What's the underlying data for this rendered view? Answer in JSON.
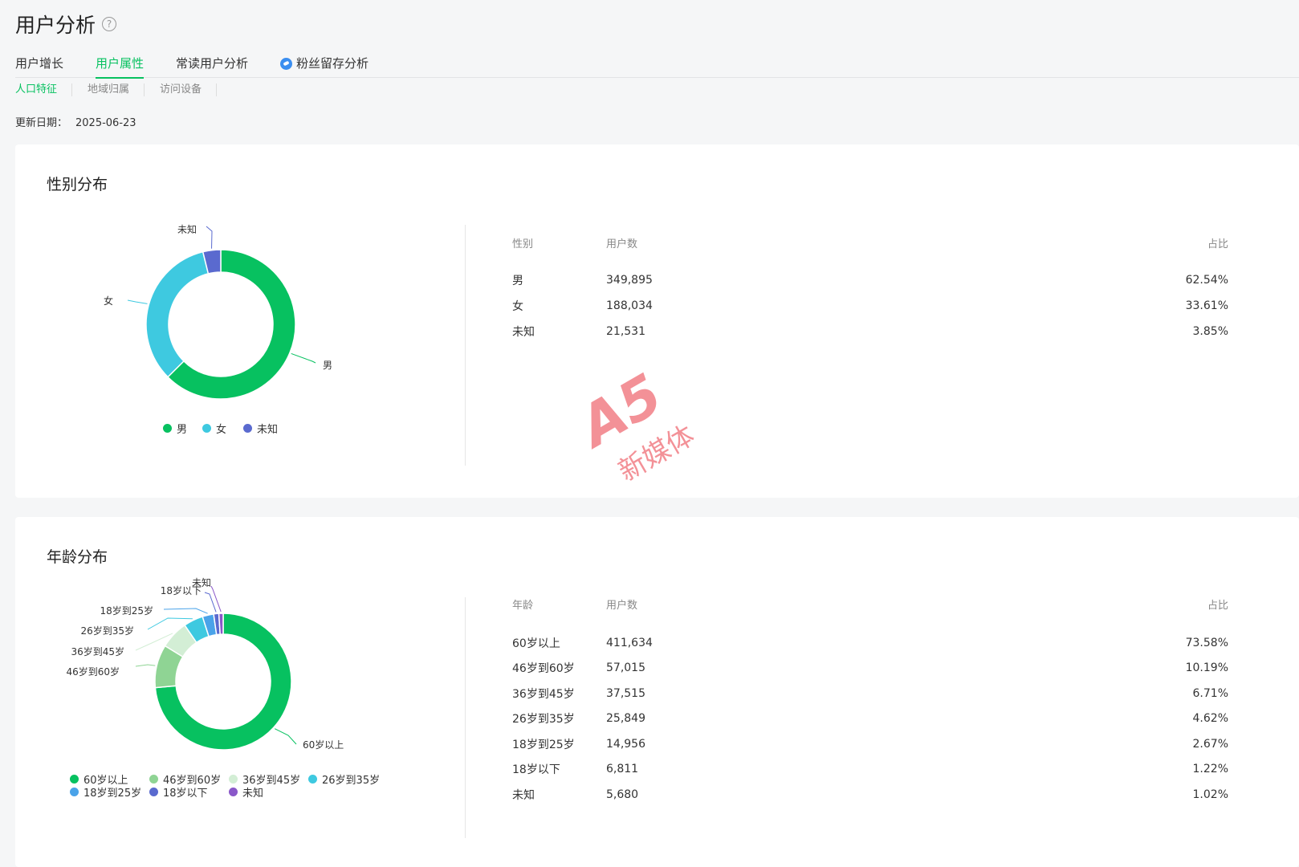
{
  "page": {
    "title": "用户分析",
    "help_icon": "question-circle-icon"
  },
  "tabs": [
    {
      "label": "用户增长",
      "active": false
    },
    {
      "label": "用户属性",
      "active": true
    },
    {
      "label": "常读用户分析",
      "active": false
    },
    {
      "label": "粉丝留存分析",
      "active": false,
      "icon": "badge-icon"
    }
  ],
  "subtabs": [
    {
      "label": "人口特征",
      "active": true
    },
    {
      "label": "地域归属",
      "active": false
    },
    {
      "label": "访问设备",
      "active": false
    }
  ],
  "update": {
    "label": "更新日期：",
    "date": "2025-06-23"
  },
  "colors": {
    "accent": "#07c160",
    "male": "#07c160",
    "female": "#3ec9e0",
    "unknown_gender": "#5a6acf",
    "age_60plus": "#07c160",
    "age_46_60": "#8fd494",
    "age_36_45": "#d3eed5",
    "age_26_35": "#3ec9e0",
    "age_18_25": "#4aa3e9",
    "age_under18": "#5a6acf",
    "age_unknown": "#8a58c9"
  },
  "gender": {
    "title": "性别分布",
    "headers": {
      "c1": "性别",
      "c2": "用户数",
      "c3": "占比"
    },
    "rows": [
      {
        "label": "男",
        "users": "349,895",
        "pct": "62.54%"
      },
      {
        "label": "女",
        "users": "188,034",
        "pct": "33.61%"
      },
      {
        "label": "未知",
        "users": "21,531",
        "pct": "3.85%"
      }
    ],
    "legend": [
      "男",
      "女",
      "未知"
    ]
  },
  "age": {
    "title": "年龄分布",
    "headers": {
      "c1": "年龄",
      "c2": "用户数",
      "c3": "占比"
    },
    "rows": [
      {
        "label": "60岁以上",
        "users": "411,634",
        "pct": "73.58%"
      },
      {
        "label": "46岁到60岁",
        "users": "57,015",
        "pct": "10.19%"
      },
      {
        "label": "36岁到45岁",
        "users": "37,515",
        "pct": "6.71%"
      },
      {
        "label": "26岁到35岁",
        "users": "25,849",
        "pct": "4.62%"
      },
      {
        "label": "18岁到25岁",
        "users": "14,956",
        "pct": "2.67%"
      },
      {
        "label": "18岁以下",
        "users": "6,811",
        "pct": "1.22%"
      },
      {
        "label": "未知",
        "users": "5,680",
        "pct": "1.02%"
      }
    ],
    "legend": [
      "60岁以上",
      "46岁到60岁",
      "36岁到45岁",
      "26岁到35岁",
      "18岁到25岁",
      "18岁以下",
      "未知"
    ]
  },
  "chart_data": [
    {
      "type": "pie",
      "categories": [
        "男",
        "女",
        "未知"
      ],
      "values": [
        62.54,
        33.61,
        3.85
      ],
      "title": "性别分布"
    },
    {
      "type": "pie",
      "categories": [
        "60岁以上",
        "46岁到60岁",
        "36岁到45岁",
        "26岁到35岁",
        "18岁到25岁",
        "18岁以下",
        "未知"
      ],
      "values": [
        73.58,
        10.19,
        6.71,
        4.62,
        2.67,
        1.22,
        1.02
      ],
      "title": "年龄分布"
    }
  ],
  "watermark": {
    "big": "A5",
    "small": "新媒体"
  }
}
